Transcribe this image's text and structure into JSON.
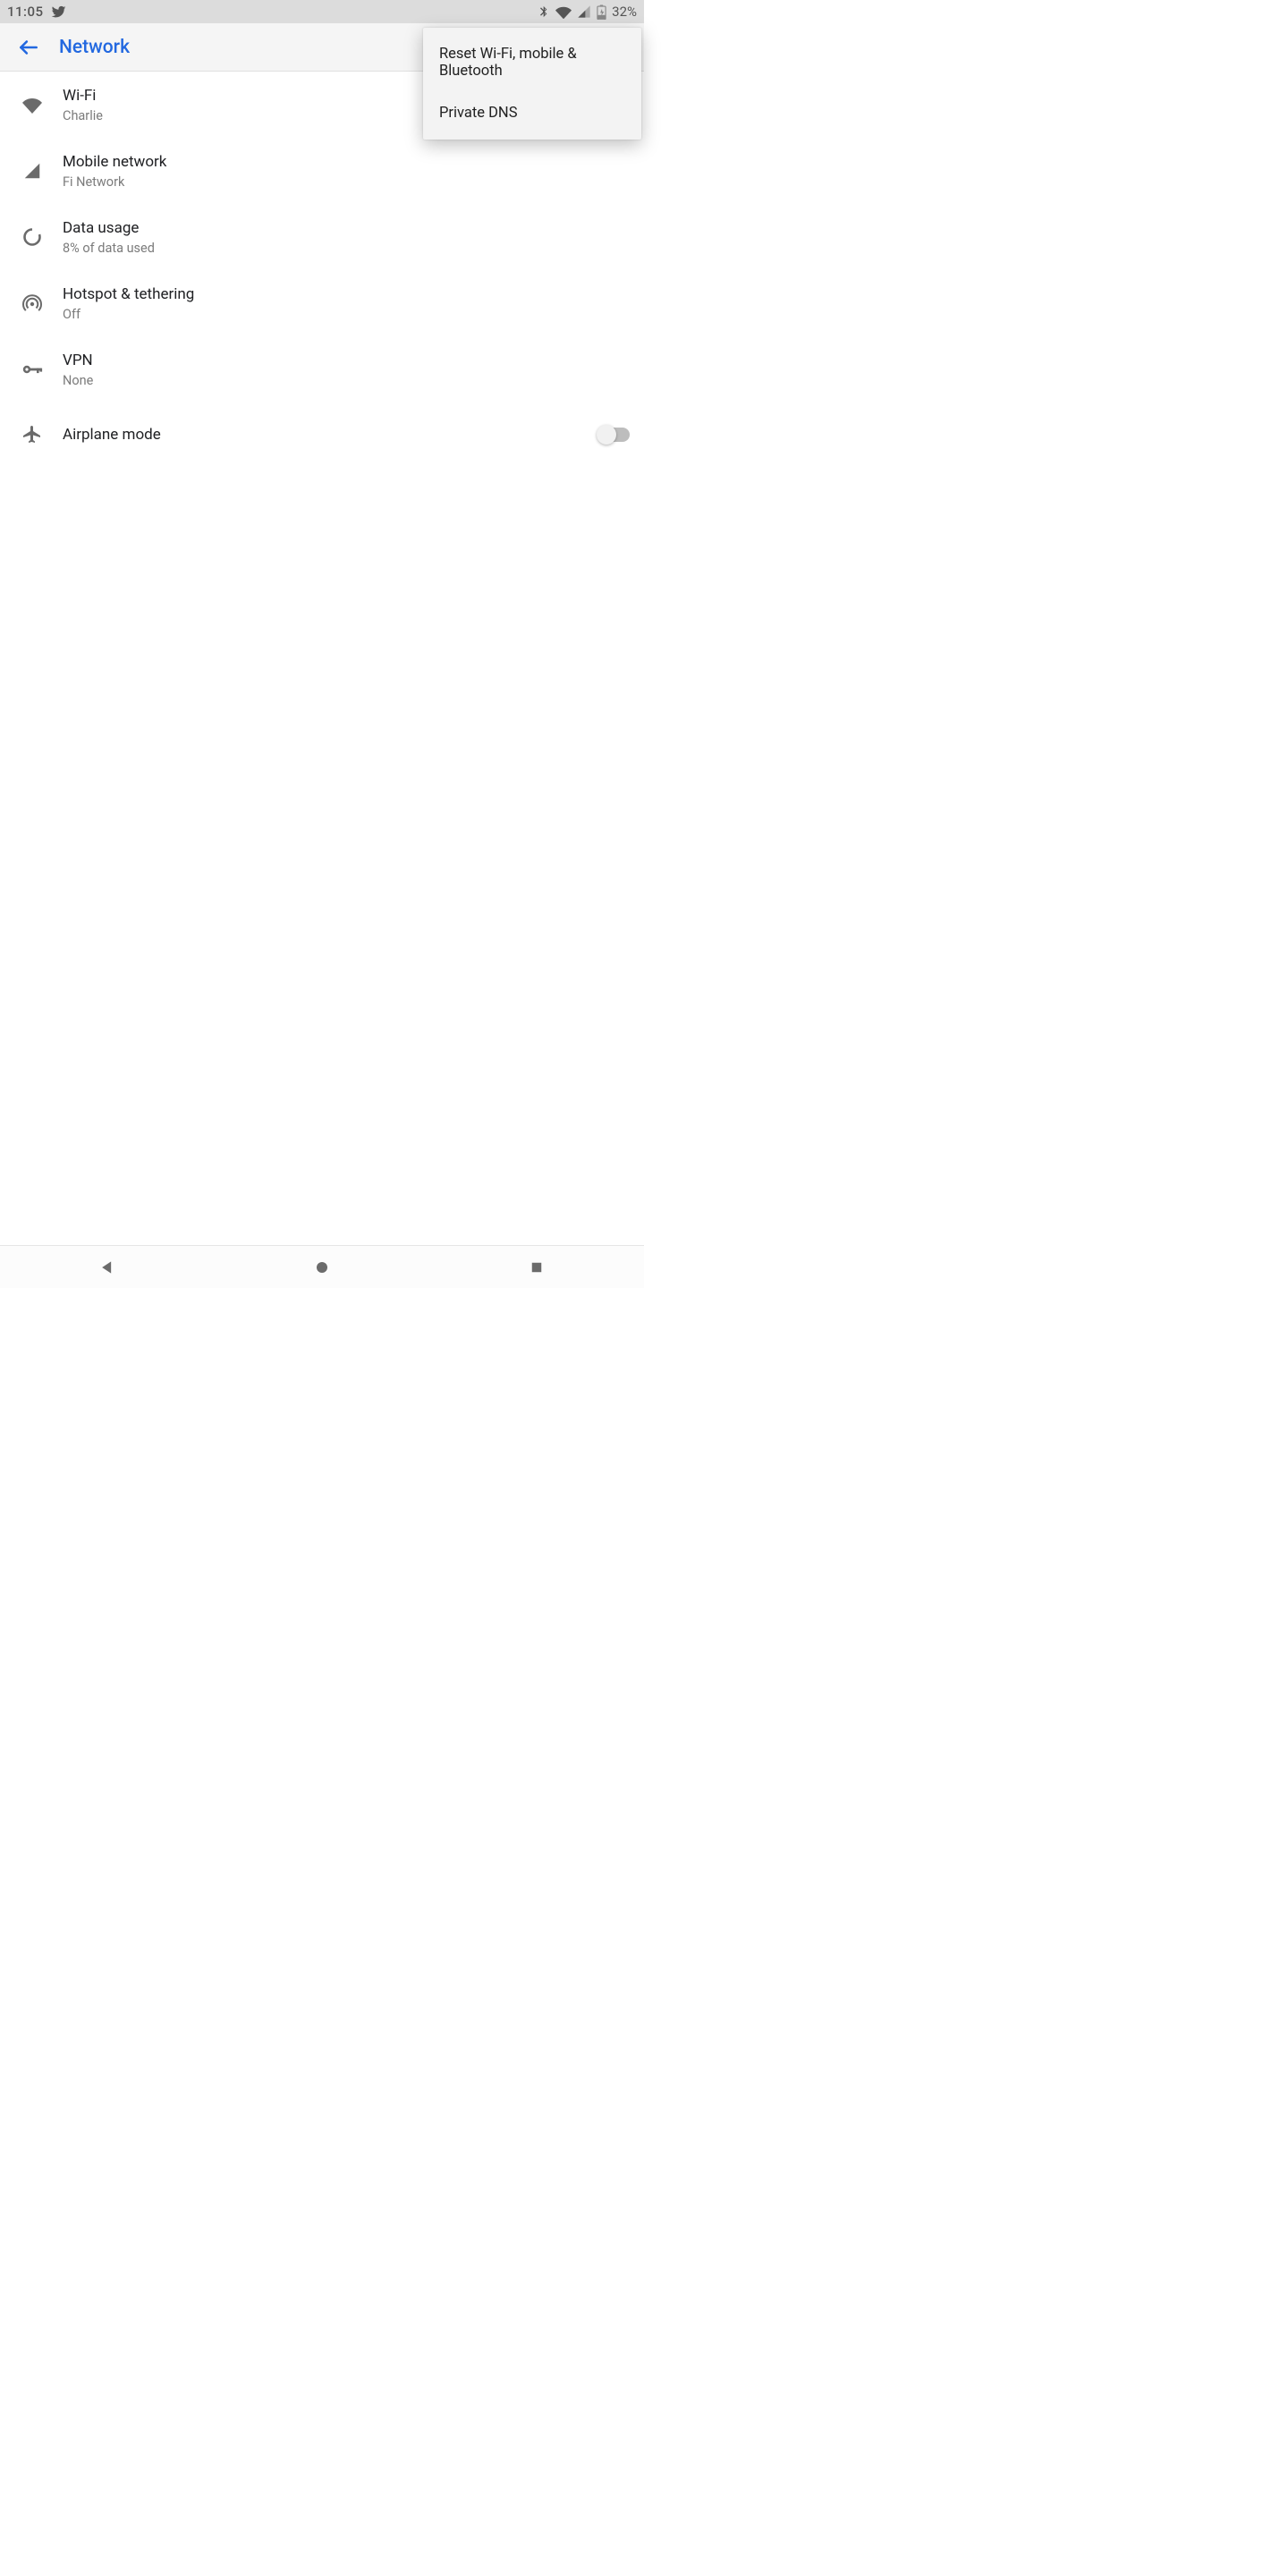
{
  "status": {
    "time": "11:05",
    "battery_percent": "32%"
  },
  "appbar": {
    "title": "Network"
  },
  "popup": {
    "items": [
      {
        "label": "Reset Wi-Fi, mobile & Bluetooth"
      },
      {
        "label": "Private DNS"
      }
    ]
  },
  "rows": {
    "wifi": {
      "title": "Wi-Fi",
      "sub": "Charlie",
      "toggle_on": true
    },
    "mobile": {
      "title": "Mobile network",
      "sub": "Fi Network"
    },
    "data": {
      "title": "Data usage",
      "sub": "8% of data used"
    },
    "hotspot": {
      "title": "Hotspot & tethering",
      "sub": "Off"
    },
    "vpn": {
      "title": "VPN",
      "sub": "None"
    },
    "airplane": {
      "title": "Airplane mode",
      "toggle_on": false
    }
  }
}
